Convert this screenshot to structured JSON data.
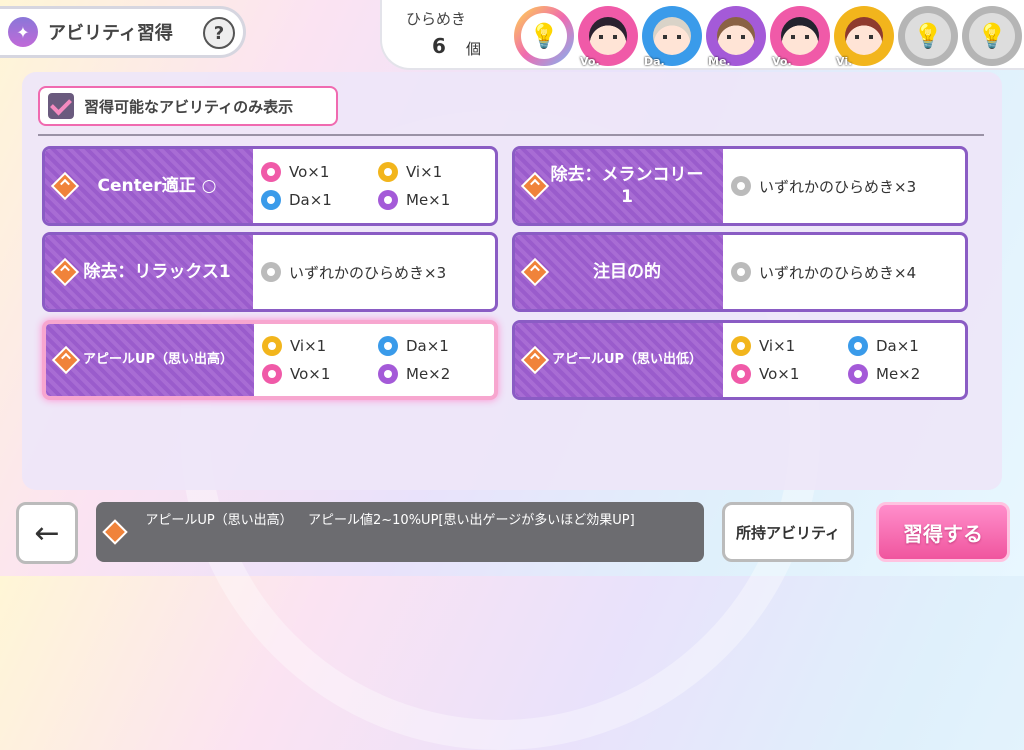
{
  "header": {
    "title": "アビリティ習得",
    "help_label": "?",
    "hirameki_label": "ひらめき",
    "hirameki_count": "6",
    "hirameki_unit": "個",
    "slots": [
      {
        "type": "bulb",
        "color": "#f5a623",
        "ring": "linear-gradient(135deg,#ffd84a,#f06ab0,#7ab8f5)"
      },
      {
        "type": "face",
        "tag": "Vo.",
        "ring": "#f05aa8",
        "hair": "#2b2230"
      },
      {
        "type": "face",
        "tag": "Da.",
        "ring": "#3a9bea",
        "hair": "#d9d3c8"
      },
      {
        "type": "face",
        "tag": "Me.",
        "ring": "#a45ad8",
        "hair": "#8a6244"
      },
      {
        "type": "face",
        "tag": "Vo.",
        "ring": "#f05aa8",
        "hair": "#23232e"
      },
      {
        "type": "face",
        "tag": "Vi.",
        "ring": "#f2b51c",
        "hair": "#8e3a2e"
      },
      {
        "type": "empty",
        "ring": "#b5b5b5"
      },
      {
        "type": "empty",
        "ring": "#b5b5b5"
      }
    ]
  },
  "filter": {
    "label": "習得可能なアビリティのみ表示",
    "checked": true
  },
  "cards": [
    {
      "name": "Center適正 ○",
      "small": false,
      "reqs": [
        {
          "gem": "vo",
          "text": "Vo×1"
        },
        {
          "gem": "vi",
          "text": "Vi×1"
        },
        {
          "gem": "da",
          "text": "Da×1"
        },
        {
          "gem": "me",
          "text": "Me×1"
        }
      ]
    },
    {
      "name": "除去：メランコリー1",
      "small": false,
      "reqs": [
        {
          "gem": "any",
          "text": "いずれかのひらめき×3"
        }
      ]
    },
    {
      "name": "除去：リラックス1",
      "small": false,
      "reqs": [
        {
          "gem": "any",
          "text": "いずれかのひらめき×3"
        }
      ]
    },
    {
      "name": "注目の的",
      "small": false,
      "reqs": [
        {
          "gem": "any",
          "text": "いずれかのひらめき×4"
        }
      ]
    },
    {
      "name": "アピールUP（思い出高）",
      "small": true,
      "selected": true,
      "reqs": [
        {
          "gem": "vi",
          "text": "Vi×1"
        },
        {
          "gem": "da",
          "text": "Da×1"
        },
        {
          "gem": "vo",
          "text": "Vo×1"
        },
        {
          "gem": "me",
          "text": "Me×2"
        }
      ]
    },
    {
      "name": "アピールUP（思い出低）",
      "small": true,
      "reqs": [
        {
          "gem": "vi",
          "text": "Vi×1"
        },
        {
          "gem": "da",
          "text": "Da×1"
        },
        {
          "gem": "vo",
          "text": "Vo×1"
        },
        {
          "gem": "me",
          "text": "Me×2"
        }
      ]
    }
  ],
  "description": {
    "name": "アピールUP（思い出高）",
    "text": "アピール値2~10%UP[思い出ゲージが多いほど効果UP]"
  },
  "buttons": {
    "back": "←",
    "owned": "所持アビリティ",
    "learn": "習得する"
  }
}
